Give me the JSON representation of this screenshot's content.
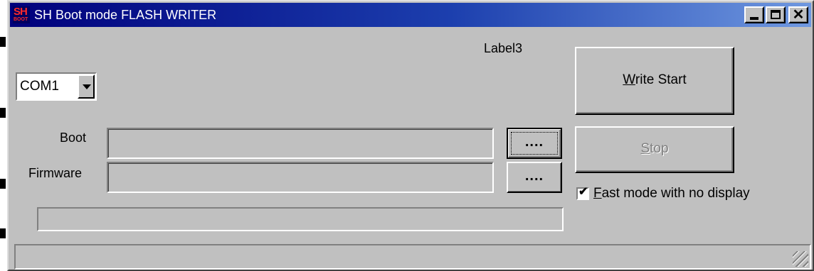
{
  "window": {
    "title": "SH Boot mode FLASH WRITER",
    "icon": {
      "line1": "SH",
      "line2": "BOOT",
      "name": "app-icon"
    },
    "controls": [
      "minimize",
      "maximize",
      "close"
    ],
    "close_glyph": "✕"
  },
  "label3": "Label3",
  "port": {
    "selected": "COM1",
    "options": [
      "COM1"
    ]
  },
  "fields": {
    "boot": {
      "label": "Boot",
      "value": "",
      "browse_label": "...."
    },
    "firmware": {
      "label": "Firmware",
      "value": "",
      "browse_label": "...."
    }
  },
  "progress": {
    "percent": 0
  },
  "buttons": {
    "write_start": {
      "mnemonic": "W",
      "rest": "rite Start",
      "enabled": true
    },
    "stop": {
      "mnemonic": "S",
      "rest": "top",
      "enabled": false
    }
  },
  "fast_mode": {
    "mnemonic": "F",
    "rest": "ast mode with no display",
    "checked": true,
    "check_glyph": "✔"
  },
  "statusbar": {
    "text": ""
  },
  "colors": {
    "title_start": "#00007c",
    "title_end": "#6f98e0",
    "face": "#c0c0c0",
    "icon_text": "#ff2a2a"
  }
}
